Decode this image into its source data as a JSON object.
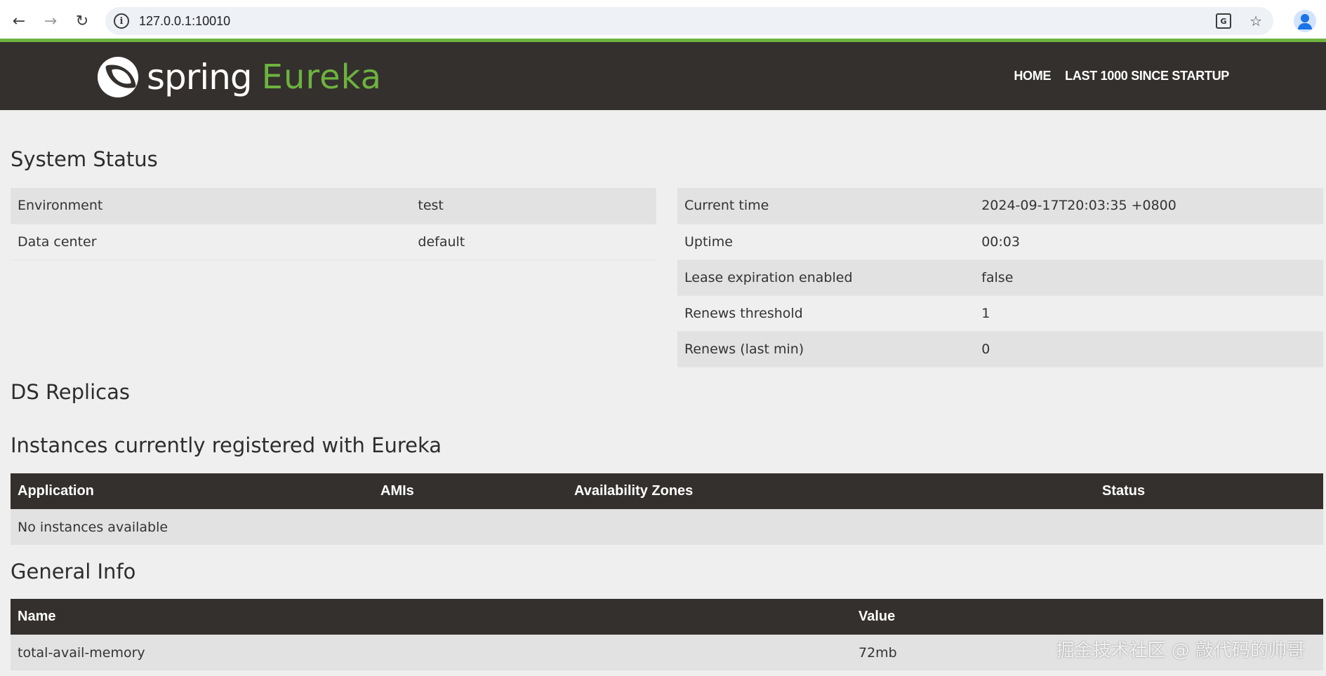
{
  "browser": {
    "url": "127.0.0.1:10010"
  },
  "header": {
    "brand_spring": "spring",
    "brand_eureka": "Eureka",
    "nav": [
      {
        "label": "HOME"
      },
      {
        "label": "LAST 1000 SINCE STARTUP"
      }
    ],
    "accent_color": "#6db33f",
    "background_color": "#34302d"
  },
  "system_status": {
    "title": "System Status",
    "left": [
      {
        "key": "Environment",
        "value": "test"
      },
      {
        "key": "Data center",
        "value": "default"
      }
    ],
    "right": [
      {
        "key": "Current time",
        "value": "2024-09-17T20:03:35 +0800"
      },
      {
        "key": "Uptime",
        "value": "00:03"
      },
      {
        "key": "Lease expiration enabled",
        "value": "false"
      },
      {
        "key": "Renews threshold",
        "value": "1"
      },
      {
        "key": "Renews (last min)",
        "value": "0"
      }
    ]
  },
  "replicas": {
    "title": "DS Replicas"
  },
  "instances": {
    "title": "Instances currently registered with Eureka",
    "columns": [
      "Application",
      "AMIs",
      "Availability Zones",
      "Status"
    ],
    "empty_message": "No instances available"
  },
  "general_info": {
    "title": "General Info",
    "columns": [
      "Name",
      "Value"
    ],
    "rows": [
      {
        "name": "total-avail-memory",
        "value": "72mb"
      }
    ]
  },
  "watermark": "掘金技术社区 @ 敲代码的帅哥"
}
